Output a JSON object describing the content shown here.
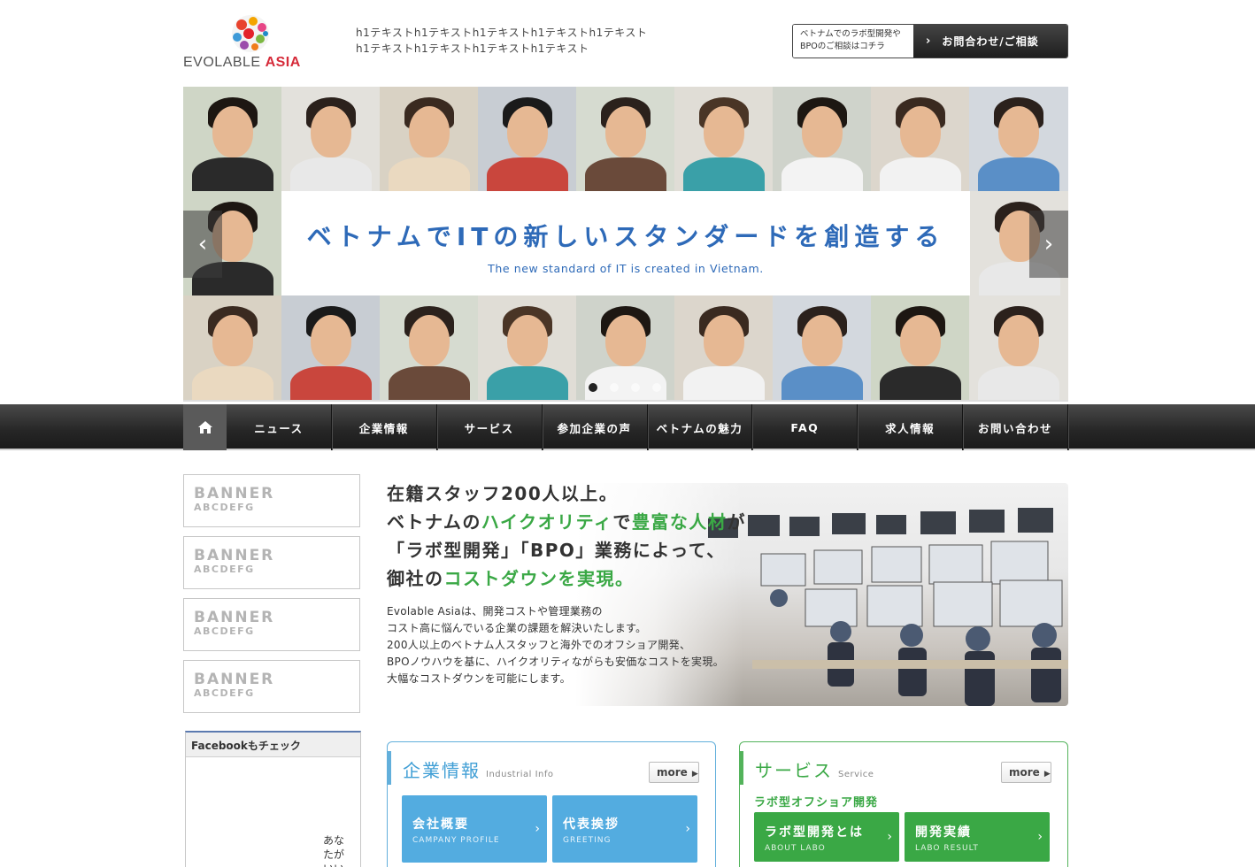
{
  "header": {
    "logo_text_1": "EVOLABLE",
    "logo_text_2": "ASIA",
    "h1_text": "h1テキストh1テキストh1テキストh1テキストh1テキストh1テキストh1テキストh1テキストh1テキスト",
    "contact_note_line1": "ベトナムでのラボ型開発や",
    "contact_note_line2": "BPOのご相談はコチラ",
    "contact_button": "お問合わせ/ご相談"
  },
  "hero": {
    "headline": "ベトナムでITの新しいスタンダードを創造する",
    "subheadline": "The new standard of IT is created in Vietnam.",
    "slides_count": 4,
    "active_slide": 1
  },
  "nav": {
    "items": [
      "ニュース",
      "企業情報",
      "サービス",
      "参加企業の声",
      "ベトナムの魅力",
      "FAQ",
      "求人情報",
      "お問い合わせ"
    ]
  },
  "sidebar": {
    "banners": [
      {
        "title": "BANNER",
        "sub": "ABCDEFG"
      },
      {
        "title": "BANNER",
        "sub": "ABCDEFG"
      },
      {
        "title": "BANNER",
        "sub": "ABCDEFG"
      },
      {
        "title": "BANNER",
        "sub": "ABCDEFG"
      }
    ],
    "facebook_title": "Facebookもチェック",
    "facebook_text": "あなたがいい"
  },
  "intro": {
    "line1": "在籍スタッフ200人以上。",
    "line2_a": "ベトナムの",
    "line2_b": "ハイクオリティ",
    "line2_c": "で",
    "line2_d": "豊富な人材",
    "line2_e": "が",
    "line3": "「ラボ型開発」「BPO」業務によって、",
    "line4_a": "御社の",
    "line4_b": "コストダウンを実現。",
    "body": [
      "Evolable Asiaは、開発コストや管理業務の",
      "コスト高に悩んでいる企業の課題を解決いたします。",
      "200人以上のベトナム人スタッフと海外でのオフショア開発、",
      "BPOノウハウを基に、ハイクオリティながらも安価なコストを実現。",
      "大幅なコストダウンを可能にします。"
    ]
  },
  "panels": {
    "company": {
      "title": "企業情報",
      "sub": "Industrial Info",
      "more": "more",
      "tiles": [
        {
          "title": "会社概要",
          "sub": "CAMPANY PROFILE"
        },
        {
          "title": "代表挨拶",
          "sub": "GREETING"
        }
      ]
    },
    "service": {
      "title": "サービス",
      "sub": "Service",
      "more": "more",
      "label": "ラボ型オフショア開発",
      "tiles": [
        {
          "title": "ラボ型開発とは",
          "sub": "ABOUT LABO"
        },
        {
          "title": "開発実績",
          "sub": "LABO RESULT"
        }
      ]
    }
  },
  "colors": {
    "accent_blue": "#2e6ab8",
    "panel_blue": "#53ace0",
    "panel_green": "#3aa845",
    "nav_dark": "#262626",
    "logo_red": "#d62b3a"
  }
}
